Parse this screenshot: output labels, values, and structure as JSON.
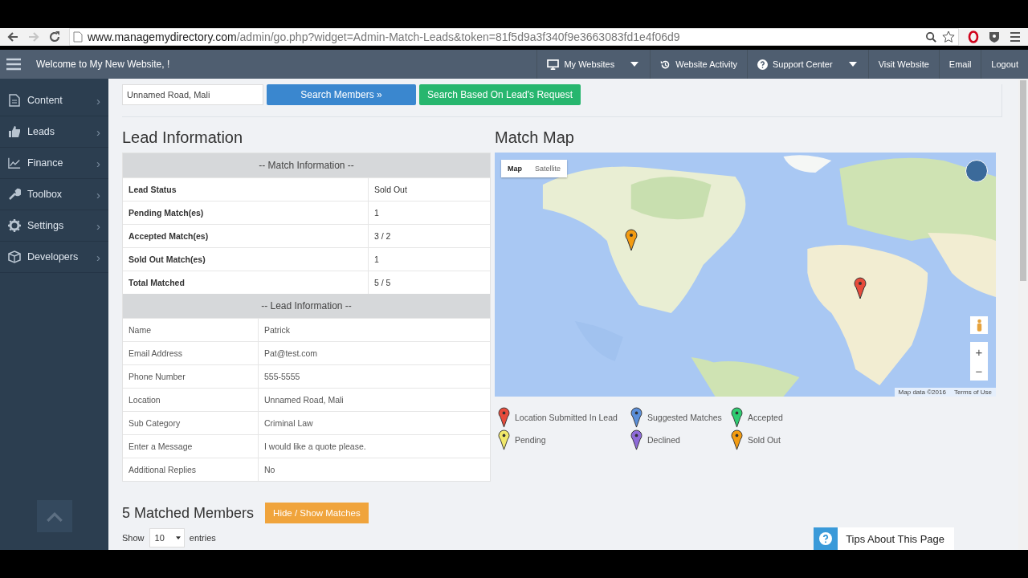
{
  "browser": {
    "back": {
      "disabled": false
    },
    "forward": {
      "disabled": true
    },
    "url_domain": "www.managemydirectory.com",
    "url_path": "/admin/go.php?widget=Admin-Match-Leads&token=81f5d9a3f340f9e3663083fd1e4f06d9"
  },
  "topbar": {
    "welcome": "Welcome to My New Website, !",
    "nav": [
      {
        "label": "My Websites",
        "kind": "monitor",
        "dropdown": true
      },
      {
        "label": "Website Activity",
        "kind": "history",
        "dropdown": false
      },
      {
        "label": "Support Center",
        "kind": "help",
        "dropdown": true
      },
      {
        "label": "Visit Website",
        "kind": "plain",
        "dropdown": false
      },
      {
        "label": "Email",
        "kind": "plain",
        "dropdown": false
      },
      {
        "label": "Logout",
        "kind": "plain",
        "dropdown": false
      }
    ]
  },
  "sidebar": {
    "items": [
      {
        "label": "Content",
        "kind": "document",
        "chevron": "›"
      },
      {
        "label": "Leads",
        "kind": "thumb",
        "chevron": "›"
      },
      {
        "label": "Finance",
        "kind": "chart",
        "chevron": "›"
      },
      {
        "label": "Toolbox",
        "kind": "wrench",
        "chevron": "›"
      },
      {
        "label": "Settings",
        "kind": "gear",
        "chevron": "›"
      },
      {
        "label": "Developers",
        "kind": "cube",
        "chevron": "›"
      }
    ]
  },
  "search": {
    "value": "Unnamed Road, Mali",
    "buttons": [
      {
        "label": "Search Members »",
        "kind": "primary"
      },
      {
        "label": "Search Based On Lead's Request",
        "kind": "success"
      }
    ]
  },
  "lead_information": {
    "title": "Lead Information",
    "sections": [
      {
        "heading": "-- Match Information --",
        "bold_labels": true,
        "rows": [
          [
            "Lead Status",
            "Sold Out"
          ],
          [
            "Pending Match(es)",
            "1"
          ],
          [
            "Accepted Match(es)",
            "3 / 2"
          ],
          [
            "Sold Out Match(es)",
            "1"
          ],
          [
            "Total Matched",
            "5 / 5"
          ]
        ]
      },
      {
        "heading": "-- Lead Information --",
        "bold_labels": false,
        "rows": [
          [
            "Name",
            "Patrick"
          ],
          [
            "Email Address",
            "Pat@test.com"
          ],
          [
            "Phone Number",
            "555-5555"
          ],
          [
            "Location",
            "Unnamed Road, Mali"
          ],
          [
            "Sub Category",
            "Criminal Law"
          ],
          [
            "Enter a Message",
            "I would like a quote please."
          ],
          [
            "Additional Replies",
            "No"
          ]
        ]
      }
    ]
  },
  "match_map": {
    "title": "Match Map",
    "map": {
      "kind": "picture",
      "map_types": [
        {
          "label": "Map",
          "selected": true
        },
        {
          "label": "Satellite",
          "selected": false
        }
      ],
      "zoom_in": "+",
      "zoom_out": "−",
      "attribution": "Map data ©2016",
      "terms": "Terms of Use",
      "markers": [
        {
          "color": "#f39c12"
        },
        {
          "color": "#e74c3c"
        }
      ]
    },
    "legend": [
      {
        "label": "Location Submitted In Lead",
        "color": "#e74c3c"
      },
      {
        "label": "Suggested Matches",
        "color": "#5b8fd9"
      },
      {
        "label": "Accepted",
        "color": "#2ecc71"
      },
      {
        "label": "Pending",
        "color": "#f1e86b"
      },
      {
        "label": "Declined",
        "color": "#8e6bd8"
      },
      {
        "label": "Sold Out",
        "color": "#f39c12"
      }
    ]
  },
  "matched": {
    "title": "5 Matched Members",
    "toggle_button": "Hide / Show Matches",
    "show_label": "Show",
    "page_size": "10",
    "entries_label": "entries"
  },
  "tips_button": "Tips About This Page"
}
